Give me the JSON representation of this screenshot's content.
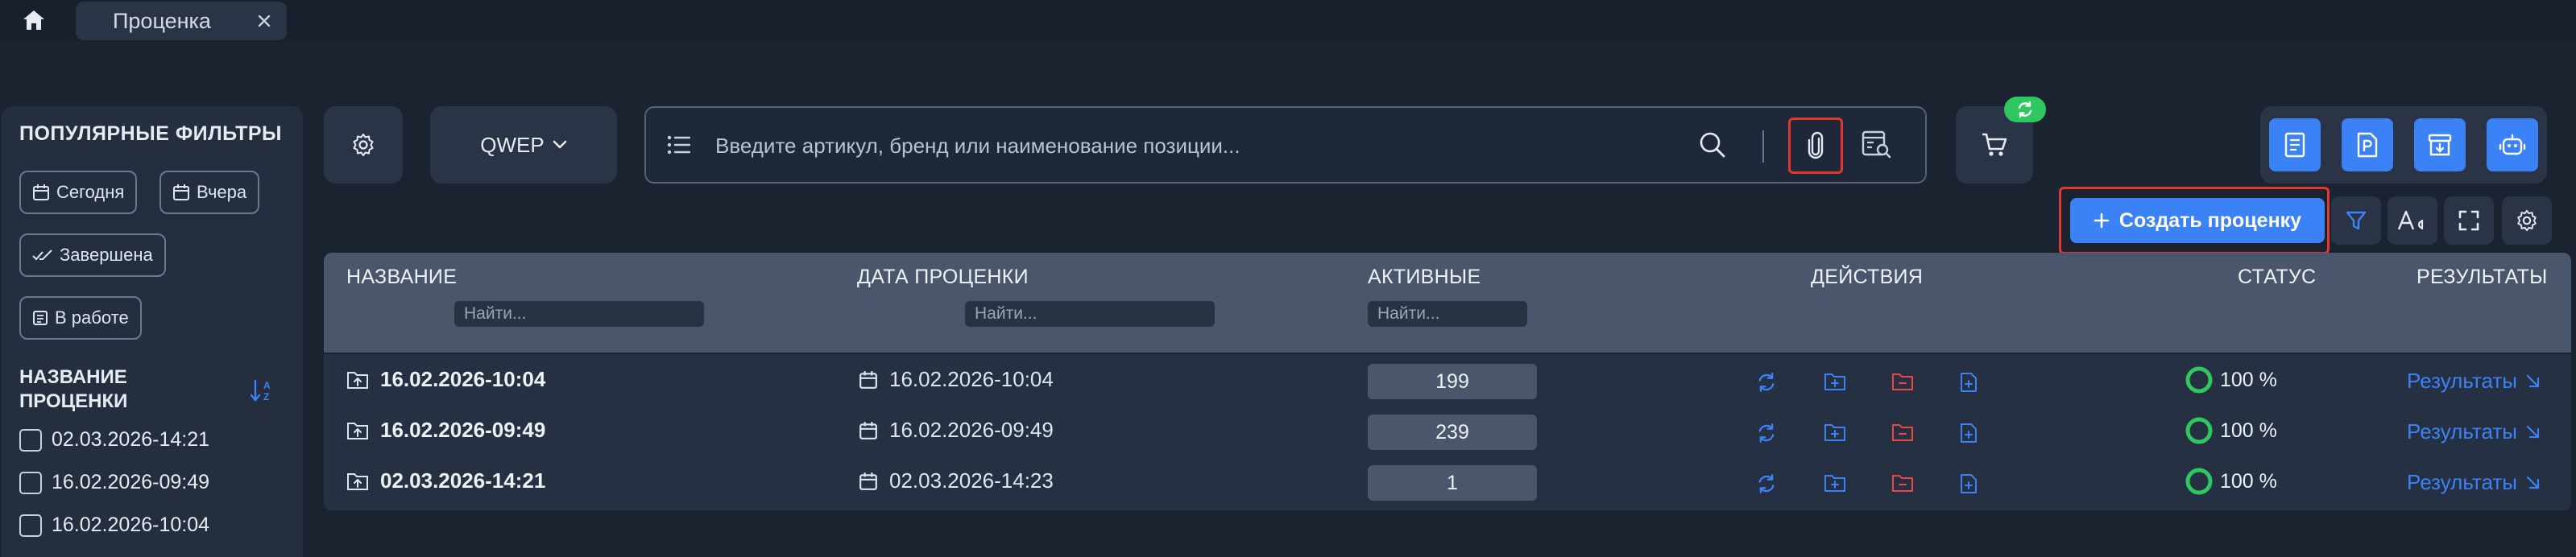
{
  "tab": {
    "title": "Проценка"
  },
  "sidebar": {
    "popular_title": "ПОПУЛЯРНЫЕ ФИЛЬТРЫ",
    "filters": [
      {
        "label": "Сегодня",
        "icon": "calendar-icon"
      },
      {
        "label": "Вчера",
        "icon": "calendar-icon"
      },
      {
        "label": "Завершена",
        "icon": "done-all-icon"
      },
      {
        "label": "В работе",
        "icon": "list-icon"
      }
    ],
    "name_section_title": "НАЗВАНИЕ ПРОЦЕНКИ",
    "name_items": [
      "02.03.2026-14:21",
      "16.02.2026-09:49",
      "16.02.2026-10:04"
    ]
  },
  "toolbar": {
    "source_select": "QWEP",
    "search_placeholder": "Введите артикул, бренд или наименование позиции...",
    "create_label": "Создать проценку"
  },
  "table": {
    "headers": {
      "name": "НАЗВАНИЕ",
      "date": "ДАТА ПРОЦЕНКИ",
      "active": "АКТИВНЫЕ",
      "actions": "ДЕЙСТВИЯ",
      "status": "СТАТУС",
      "results": "РЕЗУЛЬТАТЫ"
    },
    "filter_placeholder": "Найти...",
    "rows": [
      {
        "name": "16.02.2026-10:04",
        "date": "16.02.2026-10:04",
        "active": "199",
        "status": "100 %",
        "results": "Результаты"
      },
      {
        "name": "16.02.2026-09:49",
        "date": "16.02.2026-09:49",
        "active": "239",
        "status": "100 %",
        "results": "Результаты"
      },
      {
        "name": "02.03.2026-14:21",
        "date": "02.03.2026-14:23",
        "active": "1",
        "status": "100 %",
        "results": "Результаты"
      }
    ]
  },
  "colors": {
    "accent": "#3b82f6",
    "danger": "#ef4444",
    "success": "#2fc760",
    "highlight": "#e0382e"
  }
}
